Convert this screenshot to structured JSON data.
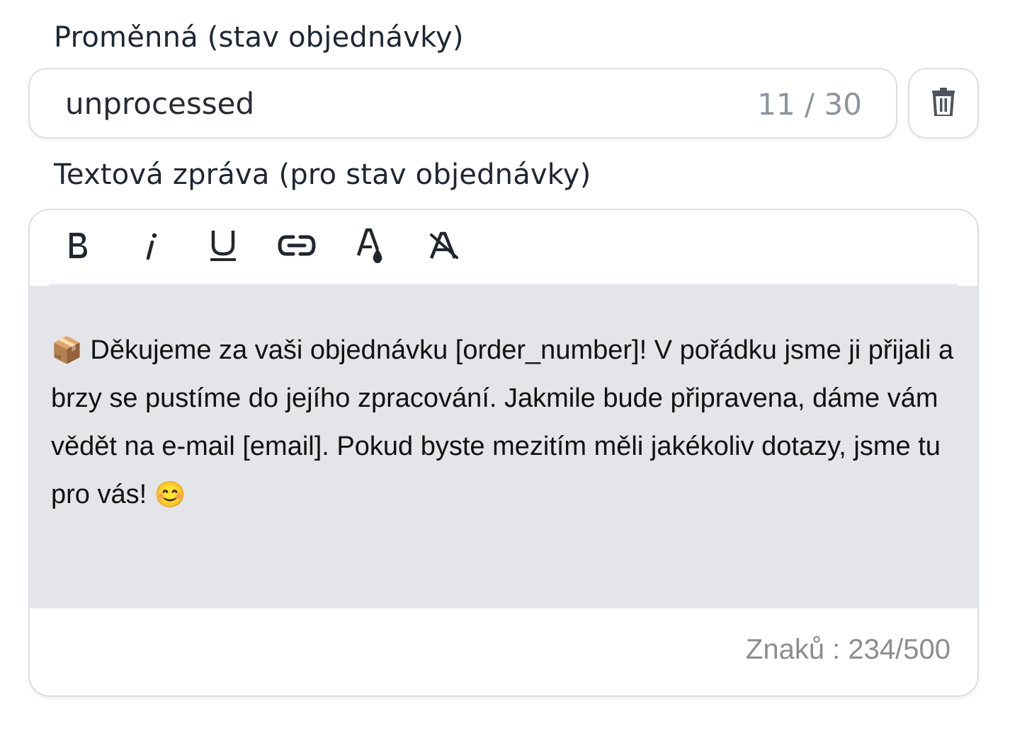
{
  "variable_field": {
    "label": "Proměnná (stav objednávky)",
    "value": "unprocessed",
    "counter": "11 / 30"
  },
  "delete_button": {
    "icon": "trash-icon"
  },
  "message_field": {
    "label": "Textová zpráva (pro stav objednávky)",
    "toolbar": [
      {
        "name": "bold",
        "icon": "bold-icon"
      },
      {
        "name": "italic",
        "icon": "italic-icon"
      },
      {
        "name": "underline",
        "icon": "underline-icon"
      },
      {
        "name": "link",
        "icon": "link-icon"
      },
      {
        "name": "text-color",
        "icon": "text-color-icon"
      },
      {
        "name": "clear-format",
        "icon": "clear-format-icon"
      }
    ],
    "content": {
      "emoji_start": "📦",
      "text": " Děkujeme za vaši objednávku [order_number]! V pořádku jsme ji přijali a brzy se pustíme do jejího zpracování. Jakmile bude připravena, dáme vám vědět na e-mail [email]. Pokud byste mezitím měli jakékoliv dotazy, jsme tu pro vás! ",
      "emoji_end": "😊"
    },
    "char_count": "Znaků : 234/500"
  }
}
